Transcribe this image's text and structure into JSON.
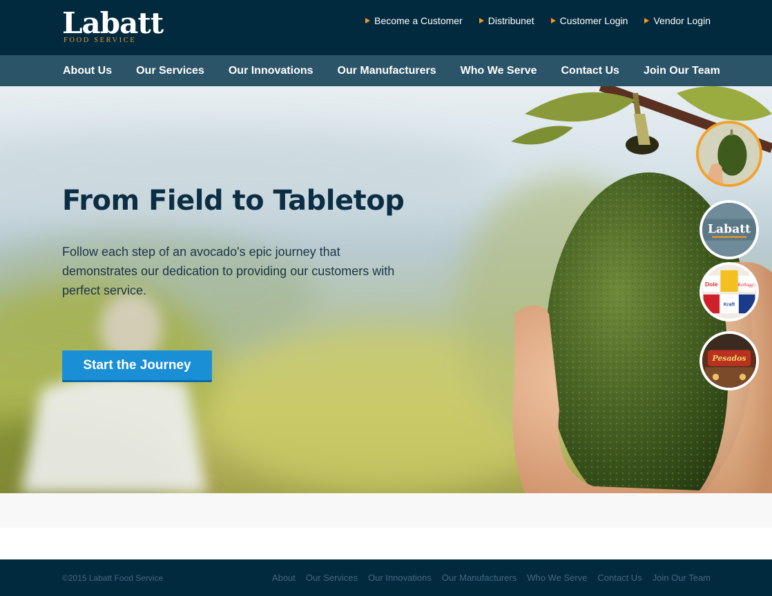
{
  "brand": {
    "name": "Labatt",
    "tagline": "FOOD SERVICE"
  },
  "utility_links": [
    {
      "label": "Become a Customer"
    },
    {
      "label": "Distribunet"
    },
    {
      "label": "Customer Login"
    },
    {
      "label": "Vendor Login"
    }
  ],
  "nav": [
    {
      "label": "About Us"
    },
    {
      "label": "Our Services"
    },
    {
      "label": "Our Innovations"
    },
    {
      "label": "Our Manufacturers"
    },
    {
      "label": "Who We Serve"
    },
    {
      "label": "Contact Us"
    },
    {
      "label": "Join Our Team"
    }
  ],
  "hero": {
    "title": "From Field to Tabletop",
    "text": "Follow each step of an avocado's epic journey that demonstrates our dedication to providing our customers with perfect service.",
    "cta_label": "Start the Journey"
  },
  "steps": [
    {
      "name": "avocado",
      "active": true
    },
    {
      "name": "labatt",
      "active": false,
      "logo_text": "Labatt"
    },
    {
      "name": "manufacturers",
      "active": false,
      "brand_texts": [
        "Dole",
        "Kellogg's",
        "Kraft"
      ]
    },
    {
      "name": "restaurant",
      "active": false,
      "sign_text": "Pesados"
    }
  ],
  "footer": {
    "copyright": "©2015 Labatt Food Service",
    "links": [
      {
        "label": "About"
      },
      {
        "label": "Our Services"
      },
      {
        "label": "Our Innovations"
      },
      {
        "label": "Our Manufacturers"
      },
      {
        "label": "Who We Serve"
      },
      {
        "label": "Contact Us"
      },
      {
        "label": "Join Our Team"
      }
    ]
  },
  "colors": {
    "header_bg": "#022a3e",
    "nav_bg": "#2c5468",
    "accent_orange": "#f29a1f",
    "cta_blue": "#1a8fd6"
  }
}
